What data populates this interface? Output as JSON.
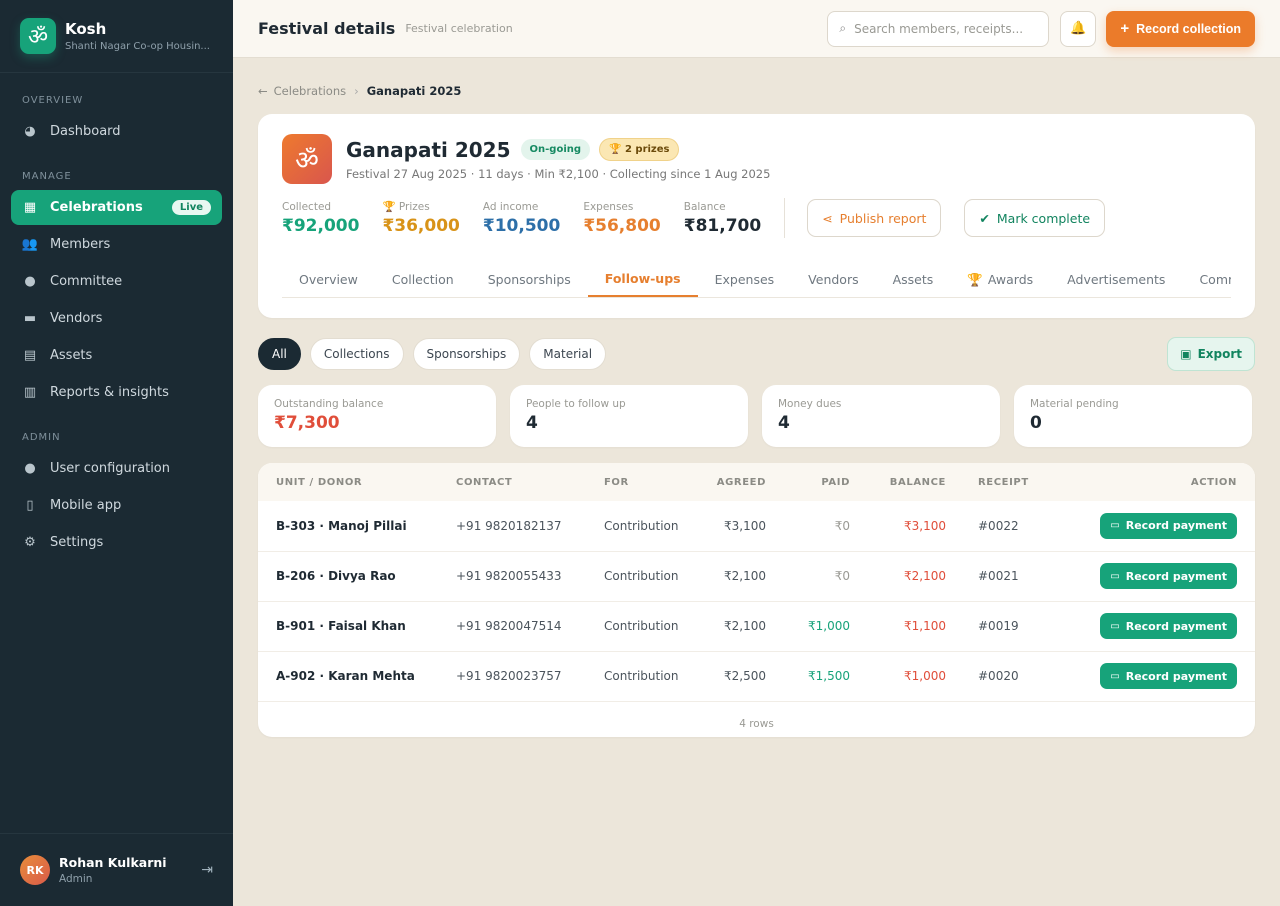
{
  "brand": {
    "name": "Kosh",
    "subtitle": "Shanti Nagar Co-op Housin...",
    "logo_glyph": "ॐ",
    "color": "#17a37a"
  },
  "sidebar": {
    "sections": [
      {
        "title": "OVERVIEW",
        "items": [
          {
            "label": "Dashboard",
            "icon": "gauge-icon"
          }
        ]
      },
      {
        "title": "MANAGE",
        "items": [
          {
            "label": "Celebrations",
            "icon": "calendar-icon",
            "active": true,
            "badge": "Live"
          },
          {
            "label": "Members",
            "icon": "users-icon"
          },
          {
            "label": "Committee",
            "icon": "user-cog-icon"
          },
          {
            "label": "Vendors",
            "icon": "truck-icon"
          },
          {
            "label": "Assets",
            "icon": "archive-icon"
          },
          {
            "label": "Reports & insights",
            "icon": "chart-icon"
          }
        ]
      },
      {
        "title": "ADMIN",
        "items": [
          {
            "label": "User configuration",
            "icon": "user-cog-icon"
          },
          {
            "label": "Mobile app",
            "icon": "mobile-icon"
          },
          {
            "label": "Settings",
            "icon": "gear-icon"
          }
        ]
      }
    ],
    "user": {
      "initials": "RK",
      "name": "Rohan Kulkarni",
      "role": "Admin"
    }
  },
  "topbar": {
    "title": "Festival details",
    "subtitle": "Festival celebration",
    "search_placeholder": "Search members, receipts...",
    "primary_label": "Record collection"
  },
  "breadcrumb": {
    "parent": "Celebrations",
    "current": "Ganapati 2025"
  },
  "festival": {
    "name": "Ganapati 2025",
    "status": "On-going",
    "prizes_badge": "2 prizes",
    "meta": "Festival 27 Aug 2025 · 11 days · Min ₹2,100 · Collecting since 1 Aug 2025",
    "stats": {
      "collected_label": "Collected",
      "collected": "₹92,000",
      "prizes_label": "Prizes",
      "prizes": "₹36,000",
      "ad_label": "Ad income",
      "ad": "₹10,500",
      "expenses_label": "Expenses",
      "expenses": "₹56,800",
      "balance_label": "Balance",
      "balance": "₹81,700"
    },
    "publish_label": "Publish report",
    "complete_label": "Mark complete",
    "tabs": [
      "Overview",
      "Collection",
      "Sponsorships",
      "Follow-ups",
      "Expenses",
      "Vendors",
      "Assets",
      "Awards",
      "Advertisements",
      "Comm"
    ],
    "active_tab": "Follow-ups"
  },
  "filters": {
    "chips": [
      "All",
      "Collections",
      "Sponsorships",
      "Material"
    ],
    "active": "All",
    "export_label": "Export"
  },
  "summary": [
    {
      "label": "Outstanding balance",
      "value": "₹7,300"
    },
    {
      "label": "People to follow up",
      "value": "4"
    },
    {
      "label": "Money dues",
      "value": "4"
    },
    {
      "label": "Material pending",
      "value": "0"
    }
  ],
  "table": {
    "headers": [
      "UNIT / DONOR",
      "CONTACT",
      "FOR",
      "AGREED",
      "PAID",
      "BALANCE",
      "RECEIPT",
      "ACTION"
    ],
    "rows": [
      {
        "donor": "B-303 · Manoj Pillai",
        "contact": "+91 9820182137",
        "for": "Contribution",
        "agreed": "₹3,100",
        "paid": "₹0",
        "balance": "₹3,100",
        "receipt": "#0022",
        "action": "Record payment"
      },
      {
        "donor": "B-206 · Divya Rao",
        "contact": "+91 9820055433",
        "for": "Contribution",
        "agreed": "₹2,100",
        "paid": "₹0",
        "balance": "₹2,100",
        "receipt": "#0021",
        "action": "Record payment"
      },
      {
        "donor": "B-901 · Faisal Khan",
        "contact": "+91 9820047514",
        "for": "Contribution",
        "agreed": "₹2,100",
        "paid": "₹1,000",
        "balance": "₹1,100",
        "receipt": "#0019",
        "action": "Record payment"
      },
      {
        "donor": "A-902 · Karan Mehta",
        "contact": "+91 9820023757",
        "for": "Contribution",
        "agreed": "₹2,500",
        "paid": "₹1,500",
        "balance": "₹1,000",
        "receipt": "#0020",
        "action": "Record payment"
      }
    ],
    "footer": "4 rows"
  }
}
